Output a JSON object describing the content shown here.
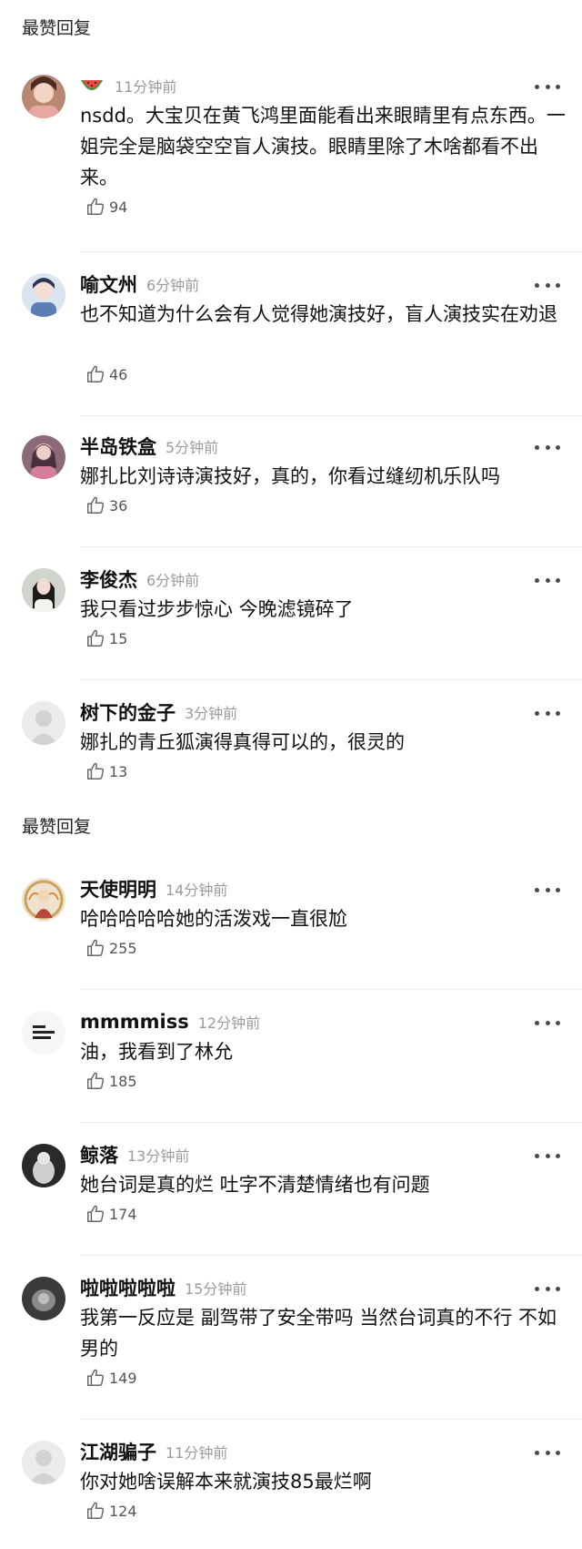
{
  "sections": [
    {
      "title": "最赞回复"
    },
    {
      "title": "最赞回复"
    }
  ],
  "comments": [
    {
      "name": "",
      "time": "11分钟前",
      "badge_icon": "watermelon-icon",
      "text": "nsdd。大宝贝在黄飞鸿里面能看出来眼睛里有点东西。一姐完全是脑袋空空盲人演技。眼睛里除了木啥都看不出来。",
      "likes": "94"
    },
    {
      "name": "喻文州",
      "time": "6分钟前",
      "text": "也不知道为什么会有人觉得她演技好，盲人演技实在劝退",
      "likes": "46"
    },
    {
      "name": "半岛铁盒",
      "time": "5分钟前",
      "text": "娜扎比刘诗诗演技好，真的，你看过缝纫机乐队吗",
      "likes": "36"
    },
    {
      "name": "李俊杰",
      "time": "6分钟前",
      "text": "我只看过步步惊心 今晚滤镜碎了",
      "likes": "15"
    },
    {
      "name": "树下的金子",
      "time": "3分钟前",
      "text": "娜扎的青丘狐演得真得可以的，很灵的",
      "likes": "13"
    },
    {
      "name": "天使明明",
      "time": "14分钟前",
      "text": "哈哈哈哈哈她的活泼戏一直很尬",
      "likes": "255"
    },
    {
      "name": "mmmmiss",
      "time": "12分钟前",
      "text": "油，我看到了林允",
      "likes": "185"
    },
    {
      "name": "鲸落",
      "time": "13分钟前",
      "text": "她台词是真的烂 吐字不清楚情绪也有问题",
      "likes": "174"
    },
    {
      "name": "啦啦啦啦啦",
      "time": "15分钟前",
      "text": "我第一反应是 副驾带了安全带吗 当然台词真的不行 不如男的",
      "likes": "149"
    },
    {
      "name": "江湖骗子",
      "time": "11分钟前",
      "text": "你对她啥误解本来就演技85最烂啊",
      "likes": "124"
    }
  ],
  "icons": {
    "like": "thumbs-up-icon",
    "more": "more-dots-icon",
    "avatar": "avatar-icon"
  },
  "colors": {
    "text": "#111111",
    "meta": "#9b9b9b",
    "divider": "#ececec"
  }
}
